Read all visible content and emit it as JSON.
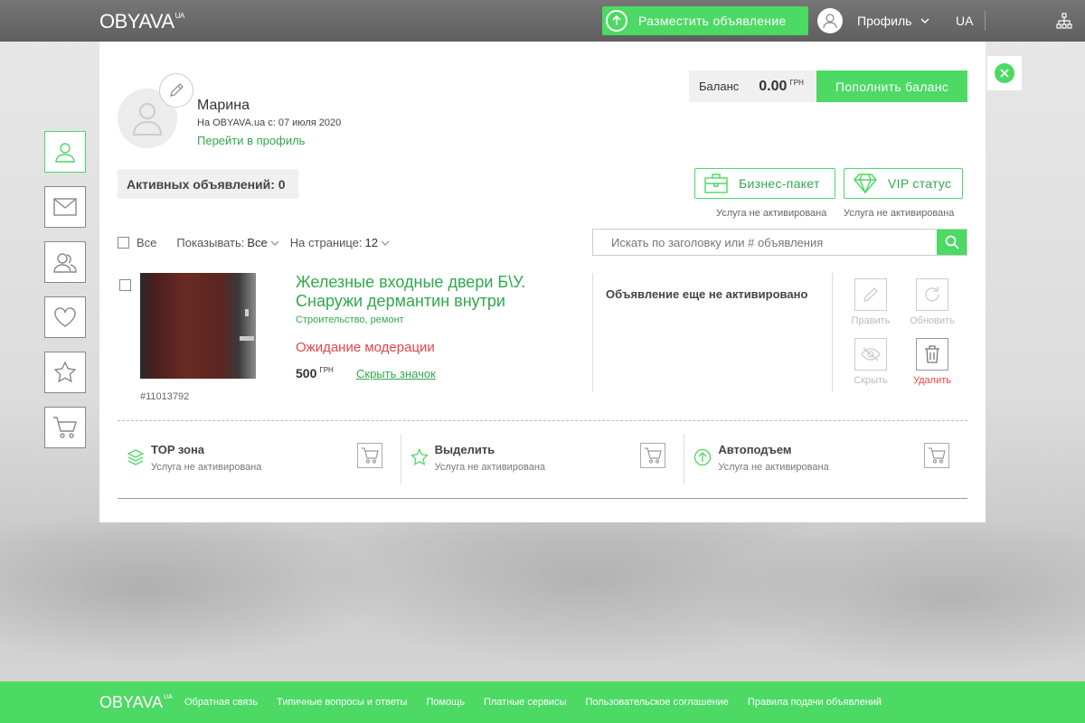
{
  "header": {
    "logo_text": "OBYAVA",
    "logo_suffix": "UA",
    "post_button": "Разместить объявление",
    "profile_label": "Профиль",
    "language": "UA"
  },
  "profile": {
    "name": "Марина",
    "since": "На OBYAVA.ua с: 07 июля 2020",
    "goto_profile": "Перейти в профиль"
  },
  "balance": {
    "label": "Баланс",
    "amount": "0.00",
    "currency": "ГРН",
    "topup_button": "Пополнить баланс"
  },
  "listings": {
    "active_count": "Активных объявлений: 0",
    "business_package": "Бизнес-пакет",
    "vip_status": "VIP статус",
    "service_not_active": "Услуга не активирована"
  },
  "filters": {
    "all_label": "Все",
    "show_label": "Показывать:",
    "show_value": "Все",
    "per_page_label": "На странице:",
    "per_page_value": "12",
    "search_placeholder": "Искать по заголовку или # объявления"
  },
  "item": {
    "title": "Железные входные двери Б\\У. Снаружи дермантин внутри",
    "category": "Строительство, ремонт",
    "status": "Ожидание модерации",
    "price": "500",
    "price_currency": "ГРН",
    "hide_badge": "Скрыть значок",
    "id": "#11013792",
    "activation_status": "Объявление еще не активировано",
    "actions": {
      "edit": "Править",
      "renew": "Обновить",
      "hide": "Скрыть",
      "delete": "Удалить"
    }
  },
  "services": [
    {
      "name": "TOP зона",
      "note": "Услуга не активирована",
      "icon": "layers-icon"
    },
    {
      "name": "Выделить",
      "note": "Услуга не активирована",
      "icon": "star-icon"
    },
    {
      "name": "Автоподъем",
      "note": "Услуга не активирована",
      "icon": "arrow-up-circle-icon"
    }
  ],
  "footer": {
    "logo_text": "OBYAVA",
    "logo_suffix": "UA",
    "links": [
      "Обратная связь",
      "Типичные вопросы и ответы",
      "Помощь",
      "Платные сервисы",
      "Пользовательское соглашение",
      "Правила подачи объявлений"
    ]
  },
  "colors": {
    "accent": "#4cd964",
    "link": "#31a84c",
    "warning": "#e64545",
    "header": "#6b6b6b"
  }
}
